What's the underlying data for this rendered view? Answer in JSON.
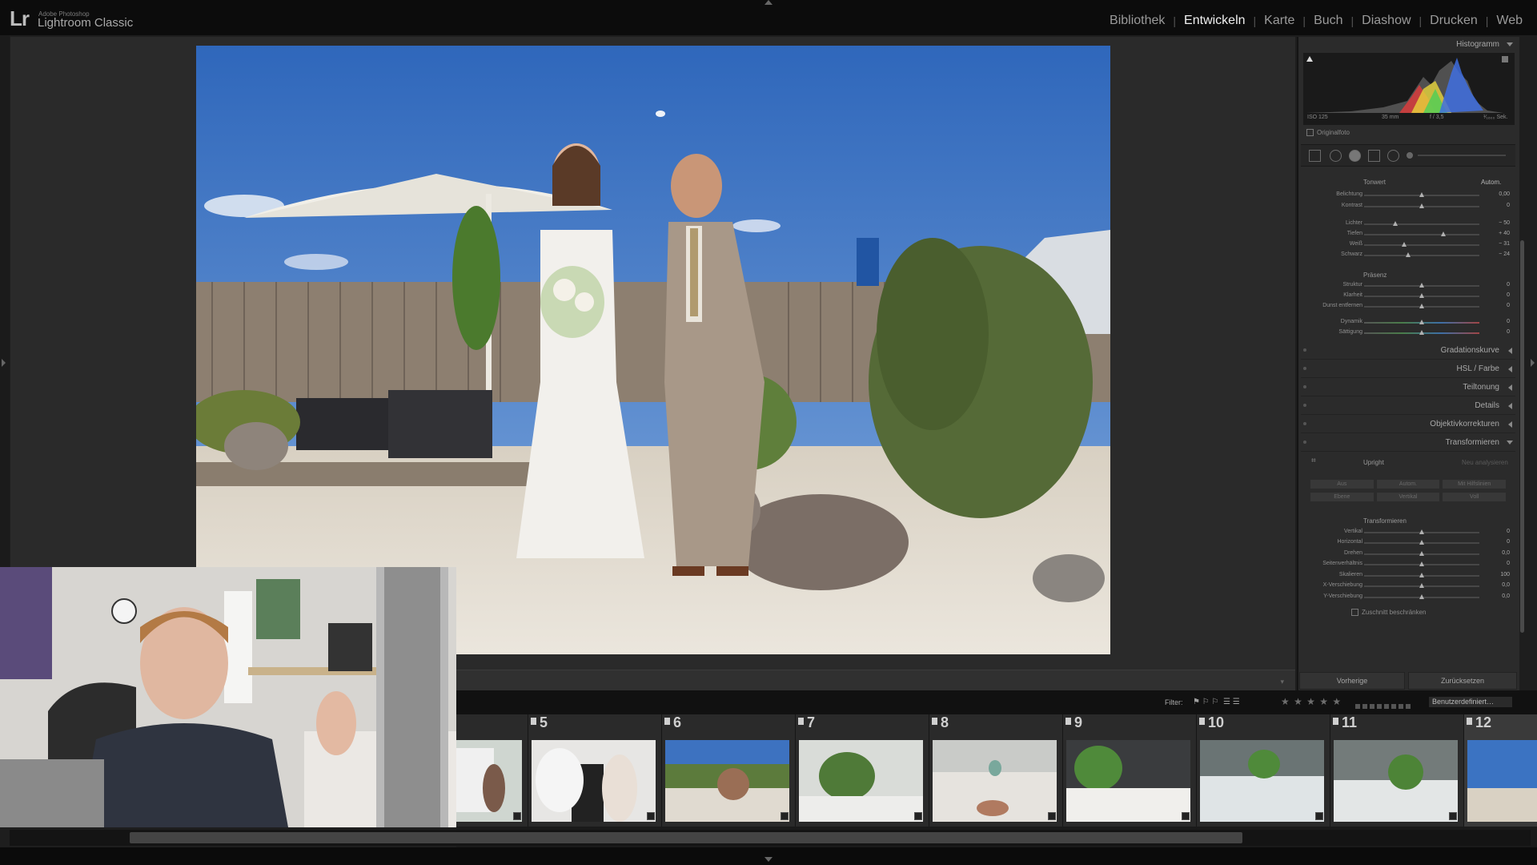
{
  "app": {
    "vendor": "Adobe Photoshop",
    "name": "Lightroom Classic",
    "logo": "Lr"
  },
  "modules": [
    "Bibliothek",
    "Entwickeln",
    "Karte",
    "Buch",
    "Diashow",
    "Drucken",
    "Web"
  ],
  "active_module": "Entwickeln",
  "histogram": {
    "title": "Histogramm",
    "iso": "ISO 125",
    "focal": "35 mm",
    "aperture": "f / 3,5",
    "shutter": "¹⁄₁₆₀₀ Sek.",
    "original_label": "Originalfoto"
  },
  "basic": {
    "tone_title": "Tonwert",
    "auto_label": "Autom.",
    "tone_sliders": [
      {
        "name": "Belichtung",
        "value": "0,00",
        "pos": 0.5
      },
      {
        "name": "Kontrast",
        "value": "0",
        "pos": 0.5
      }
    ],
    "light_sliders": [
      {
        "name": "Lichter",
        "value": "− 50",
        "pos": 0.27
      },
      {
        "name": "Tiefen",
        "value": "+ 40",
        "pos": 0.69
      },
      {
        "name": "Weiß",
        "value": "− 31",
        "pos": 0.35
      },
      {
        "name": "Schwarz",
        "value": "− 24",
        "pos": 0.38
      }
    ],
    "presence_title": "Präsenz",
    "presence_sliders": [
      {
        "name": "Struktur",
        "value": "0",
        "pos": 0.5
      },
      {
        "name": "Klarheit",
        "value": "0",
        "pos": 0.5
      },
      {
        "name": "Dunst entfernen",
        "value": "0",
        "pos": 0.5
      }
    ],
    "color_sliders": [
      {
        "name": "Dynamik",
        "value": "0",
        "pos": 0.5
      },
      {
        "name": "Sättigung",
        "value": "0",
        "pos": 0.5
      }
    ]
  },
  "panels": {
    "gradation": "Gradationskurve",
    "hsl": "HSL / Farbe",
    "split": "Teiltonung",
    "details": "Details",
    "lens": "Objektivkorrekturen",
    "transform": "Transformieren"
  },
  "transform": {
    "upright_label": "Upright",
    "reanalyze": "Neu analysieren",
    "buttons_row1": [
      "Aus",
      "Autom.",
      "Mit Hilfslinien"
    ],
    "buttons_row2": [
      "Ebene",
      "Vertikal",
      "Voll"
    ],
    "section_title": "Transformieren",
    "sliders": [
      {
        "name": "Vertikal",
        "value": "0",
        "pos": 0.5
      },
      {
        "name": "Horizontal",
        "value": "0",
        "pos": 0.5
      },
      {
        "name": "Drehen",
        "value": "0,0",
        "pos": 0.5
      },
      {
        "name": "Seitenverhältnis",
        "value": "0",
        "pos": 0.5
      },
      {
        "name": "Skalieren",
        "value": "100",
        "pos": 0.5
      },
      {
        "name": "X-Verschiebung",
        "value": "0,0",
        "pos": 0.5
      },
      {
        "name": "Y-Verschiebung",
        "value": "0,0",
        "pos": 0.5
      }
    ],
    "constrain_label": "Zuschnitt beschränken"
  },
  "bottom_buttons": {
    "previous": "Vorherige",
    "reset": "Zurücksetzen"
  },
  "filmstrip": {
    "filter_label": "Filter:",
    "custom_filter": "Benutzerdefiniert…",
    "stars": "★ ★ ★ ★ ★",
    "numbers": [
      "5",
      "6",
      "7",
      "8",
      "9",
      "10",
      "11",
      "12"
    ]
  },
  "colors": {
    "accent_active": "#f0f0f0",
    "panel_bg": "#2b2b2b",
    "sky": "#3f78c8"
  }
}
